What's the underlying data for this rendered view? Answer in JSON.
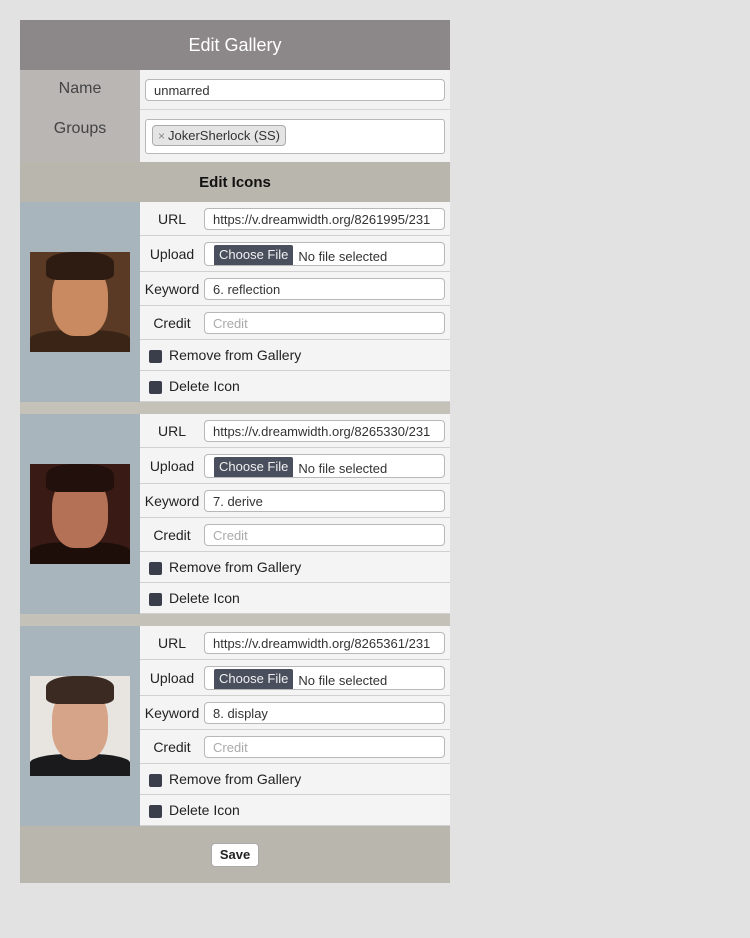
{
  "title": "Edit Gallery",
  "meta": {
    "name_label": "Name",
    "name_value": "unmarred",
    "groups_label": "Groups",
    "groups": [
      {
        "remove_glyph": "×",
        "label": "JokerSherlock (SS)"
      }
    ]
  },
  "edit_icons_header": "Edit Icons",
  "icons": [
    {
      "url_label": "URL",
      "url_value": "https://v.dreamwidth.org/8261995/231",
      "upload_label": "Upload",
      "choose_file": "Choose File",
      "no_file": "No file selected",
      "keyword_label": "Keyword",
      "keyword_value": "6. reflection",
      "credit_label": "Credit",
      "credit_placeholder": "Credit",
      "remove_label": "Remove from Gallery",
      "delete_label": "Delete Icon",
      "colors": {
        "bg": "#5a3a24",
        "face": "#c98a62",
        "hair": "#2e1c12",
        "shoulders": "#3a2416"
      }
    },
    {
      "url_label": "URL",
      "url_value": "https://v.dreamwidth.org/8265330/231",
      "upload_label": "Upload",
      "choose_file": "Choose File",
      "no_file": "No file selected",
      "keyword_label": "Keyword",
      "keyword_value": "7. derive",
      "credit_label": "Credit",
      "credit_placeholder": "Credit",
      "remove_label": "Remove from Gallery",
      "delete_label": "Delete Icon",
      "colors": {
        "bg": "#3a1a14",
        "face": "#b57156",
        "hair": "#22100c",
        "shoulders": "#1d0e0a"
      }
    },
    {
      "url_label": "URL",
      "url_value": "https://v.dreamwidth.org/8265361/231",
      "upload_label": "Upload",
      "choose_file": "Choose File",
      "no_file": "No file selected",
      "keyword_label": "Keyword",
      "keyword_value": "8. display",
      "credit_label": "Credit",
      "credit_placeholder": "Credit",
      "remove_label": "Remove from Gallery",
      "delete_label": "Delete Icon",
      "colors": {
        "bg": "#e8e4e0",
        "face": "#d6a488",
        "hair": "#3a2a22",
        "shoulders": "#1a1a1c"
      }
    }
  ],
  "save_label": "Save"
}
